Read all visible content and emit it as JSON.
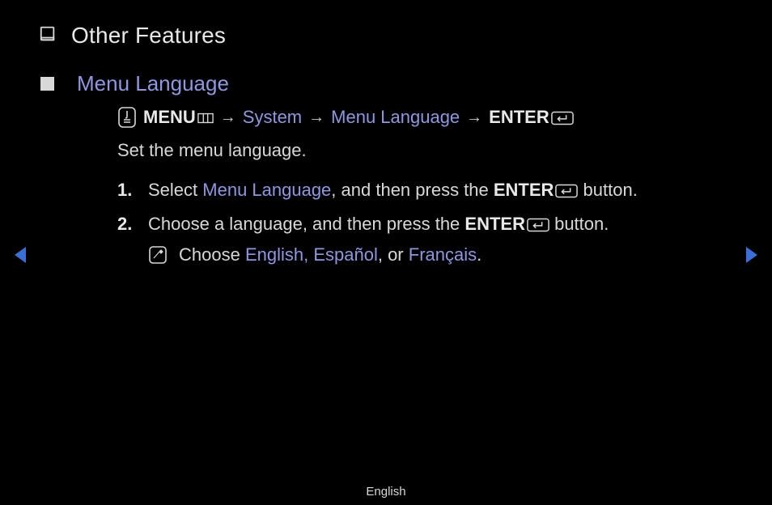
{
  "page_title": "Other Features",
  "section": {
    "title": "Menu Language",
    "breadcrumb": {
      "menu_label": "MENU",
      "step1": "System",
      "step2": "Menu Language",
      "enter_label": "ENTER",
      "arrow": "→"
    },
    "description": "Set the menu language.",
    "steps": [
      {
        "num": "1.",
        "pre": "Select ",
        "link": "Menu Language",
        "mid": ", and then press the ",
        "enter": "ENTER",
        "post": " button."
      },
      {
        "num": "2.",
        "pre": "Choose a language, and then press the ",
        "enter": "ENTER",
        "post": " button.",
        "note": {
          "pre": "Choose ",
          "langs": "English, Español",
          "mid": ", or ",
          "lang_last": "Français",
          "end": "."
        }
      }
    ]
  },
  "footer": {
    "language": "English"
  }
}
